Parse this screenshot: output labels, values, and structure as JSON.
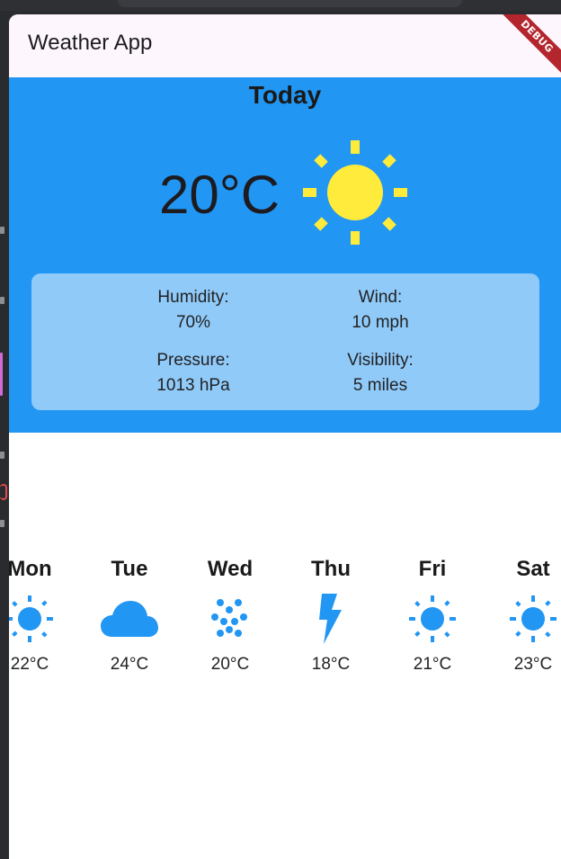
{
  "app": {
    "title": "Weather App",
    "debug_banner": "DEBUG"
  },
  "today": {
    "heading": "Today",
    "temperature": "20°C",
    "icon": "sun-icon",
    "details": {
      "humidity_label": "Humidity:",
      "humidity_value": "70%",
      "wind_label": "Wind:",
      "wind_value": "10 mph",
      "pressure_label": "Pressure:",
      "pressure_value": "1013 hPa",
      "visibility_label": "Visibility:",
      "visibility_value": "5 miles"
    }
  },
  "forecast": [
    {
      "day": "Mon",
      "temp": "22°C",
      "icon": "sun-icon"
    },
    {
      "day": "Tue",
      "temp": "24°C",
      "icon": "cloud-icon"
    },
    {
      "day": "Wed",
      "temp": "20°C",
      "icon": "rain-icon"
    },
    {
      "day": "Thu",
      "temp": "18°C",
      "icon": "thunder-icon"
    },
    {
      "day": "Fri",
      "temp": "21°C",
      "icon": "sun-icon"
    },
    {
      "day": "Sat",
      "temp": "23°C",
      "icon": "sun-icon"
    }
  ],
  "colors": {
    "panel": "#2196f3",
    "card": "#90caf9",
    "sun_yellow": "#ffeb3b",
    "icon_blue": "#2196f3"
  }
}
